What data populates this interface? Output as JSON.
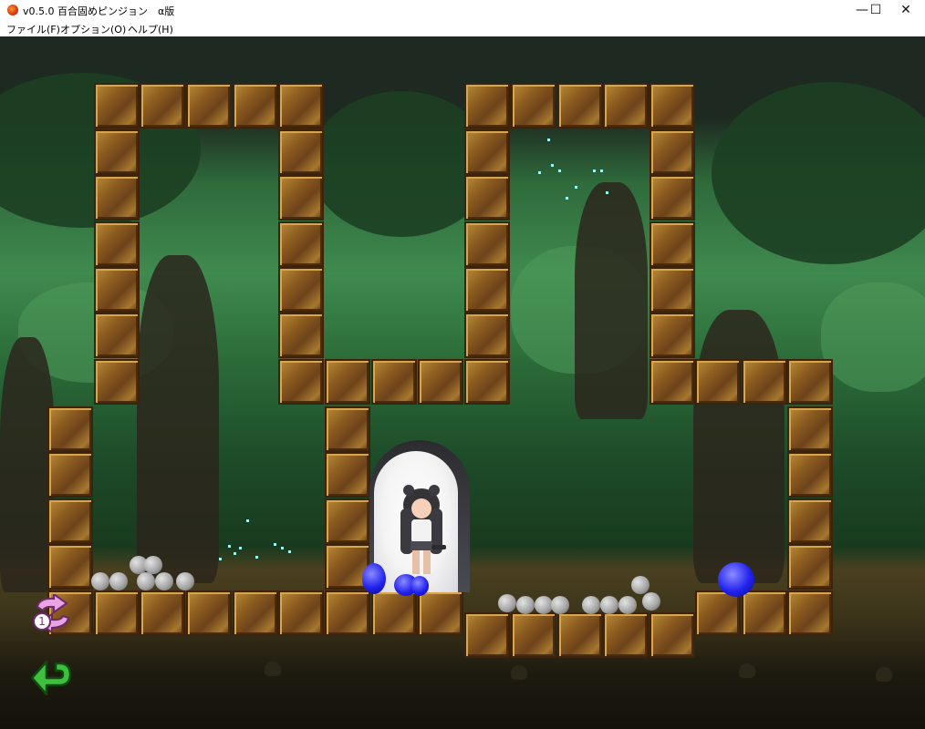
{
  "window": {
    "title": "v0.5.0 百合固めピンジョン　α版",
    "controls": {
      "minimize": "—",
      "maximize": "☐",
      "close": "✕"
    }
  },
  "menu": {
    "items": [
      "ファイル(F)",
      "オプション(O)",
      "ヘルプ(H)"
    ]
  },
  "game": {
    "scene": "jungle-dungeon",
    "hud": {
      "swap_counter": "1",
      "swap_icon_color": "#e9a3e3",
      "undo_icon_color": "#3fbf3f"
    },
    "colors": {
      "brick": "#8a5a1f",
      "orb": "#2222ee",
      "boulder": "#a6a6a6",
      "foliage": "#3f8a4f"
    }
  }
}
